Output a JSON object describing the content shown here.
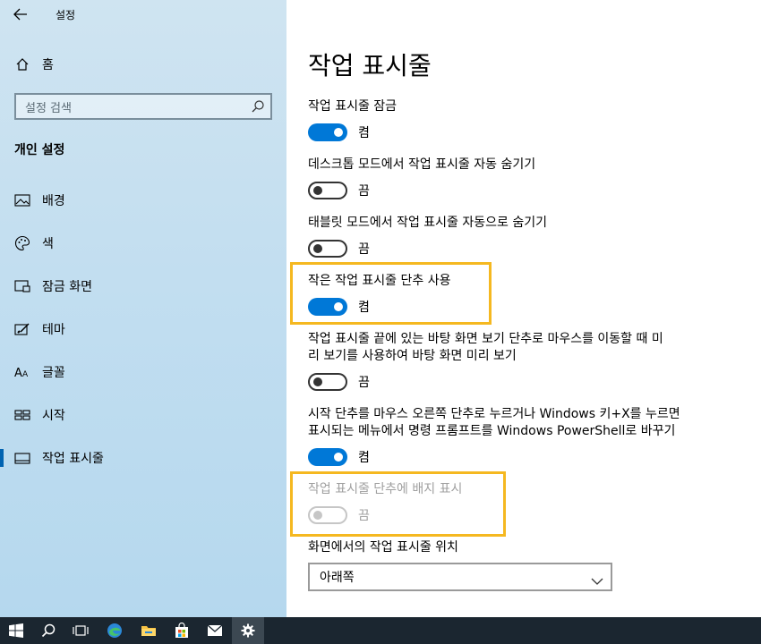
{
  "app": {
    "title": "설정"
  },
  "sidebar": {
    "home_label": "홈",
    "search_placeholder": "설정 검색",
    "group_heading": "개인 설정",
    "items": [
      {
        "label": "배경",
        "icon": "picture-icon"
      },
      {
        "label": "색",
        "icon": "palette-icon"
      },
      {
        "label": "잠금 화면",
        "icon": "lock-screen-icon"
      },
      {
        "label": "테마",
        "icon": "theme-brush-icon"
      },
      {
        "label": "글꼴",
        "icon": "font-icon"
      },
      {
        "label": "시작",
        "icon": "start-tiles-icon"
      },
      {
        "label": "작업 표시줄",
        "icon": "taskbar-icon",
        "selected": true
      }
    ]
  },
  "main": {
    "title": "작업 표시줄",
    "settings": [
      {
        "label": "작업 표시줄 잠금",
        "state": "켬",
        "on": true
      },
      {
        "label": "데스크톱 모드에서 작업 표시줄 자동 숨기기",
        "state": "끔",
        "on": false
      },
      {
        "label": "태블릿 모드에서 작업 표시줄 자동으로 숨기기",
        "state": "끔",
        "on": false
      },
      {
        "label": "작은 작업 표시줄 단추 사용",
        "state": "켬",
        "on": true
      },
      {
        "label_line1": "작업 표시줄 끝에 있는 바탕 화면 보기 단추로 마우스를 이동할 때 미",
        "label_line2": "리 보기를 사용하여 바탕 화면 미리 보기",
        "state": "끔",
        "on": false
      },
      {
        "label_line1": "시작 단추를 마우스 오른쪽 단추로 누르거나 Windows 키+X를 누르면",
        "label_line2": "표시되는 메뉴에서 명령 프롬프트를 Windows PowerShell로 바꾸기",
        "state": "켬",
        "on": true
      },
      {
        "label": "작업 표시줄 단추에 배지 표시",
        "state": "끔",
        "on": false,
        "disabled": true
      }
    ],
    "position": {
      "label": "화면에서의 작업 표시줄 위치",
      "value": "아래쪽"
    }
  },
  "taskbar": {
    "buttons": [
      "start-icon",
      "search-icon",
      "task-view-icon",
      "edge-icon",
      "file-explorer-icon",
      "store-icon",
      "mail-icon",
      "settings-gear-icon"
    ]
  },
  "colors": {
    "accent": "#0078d7",
    "highlight": "#f5b820",
    "taskbar": "#1b2630"
  }
}
